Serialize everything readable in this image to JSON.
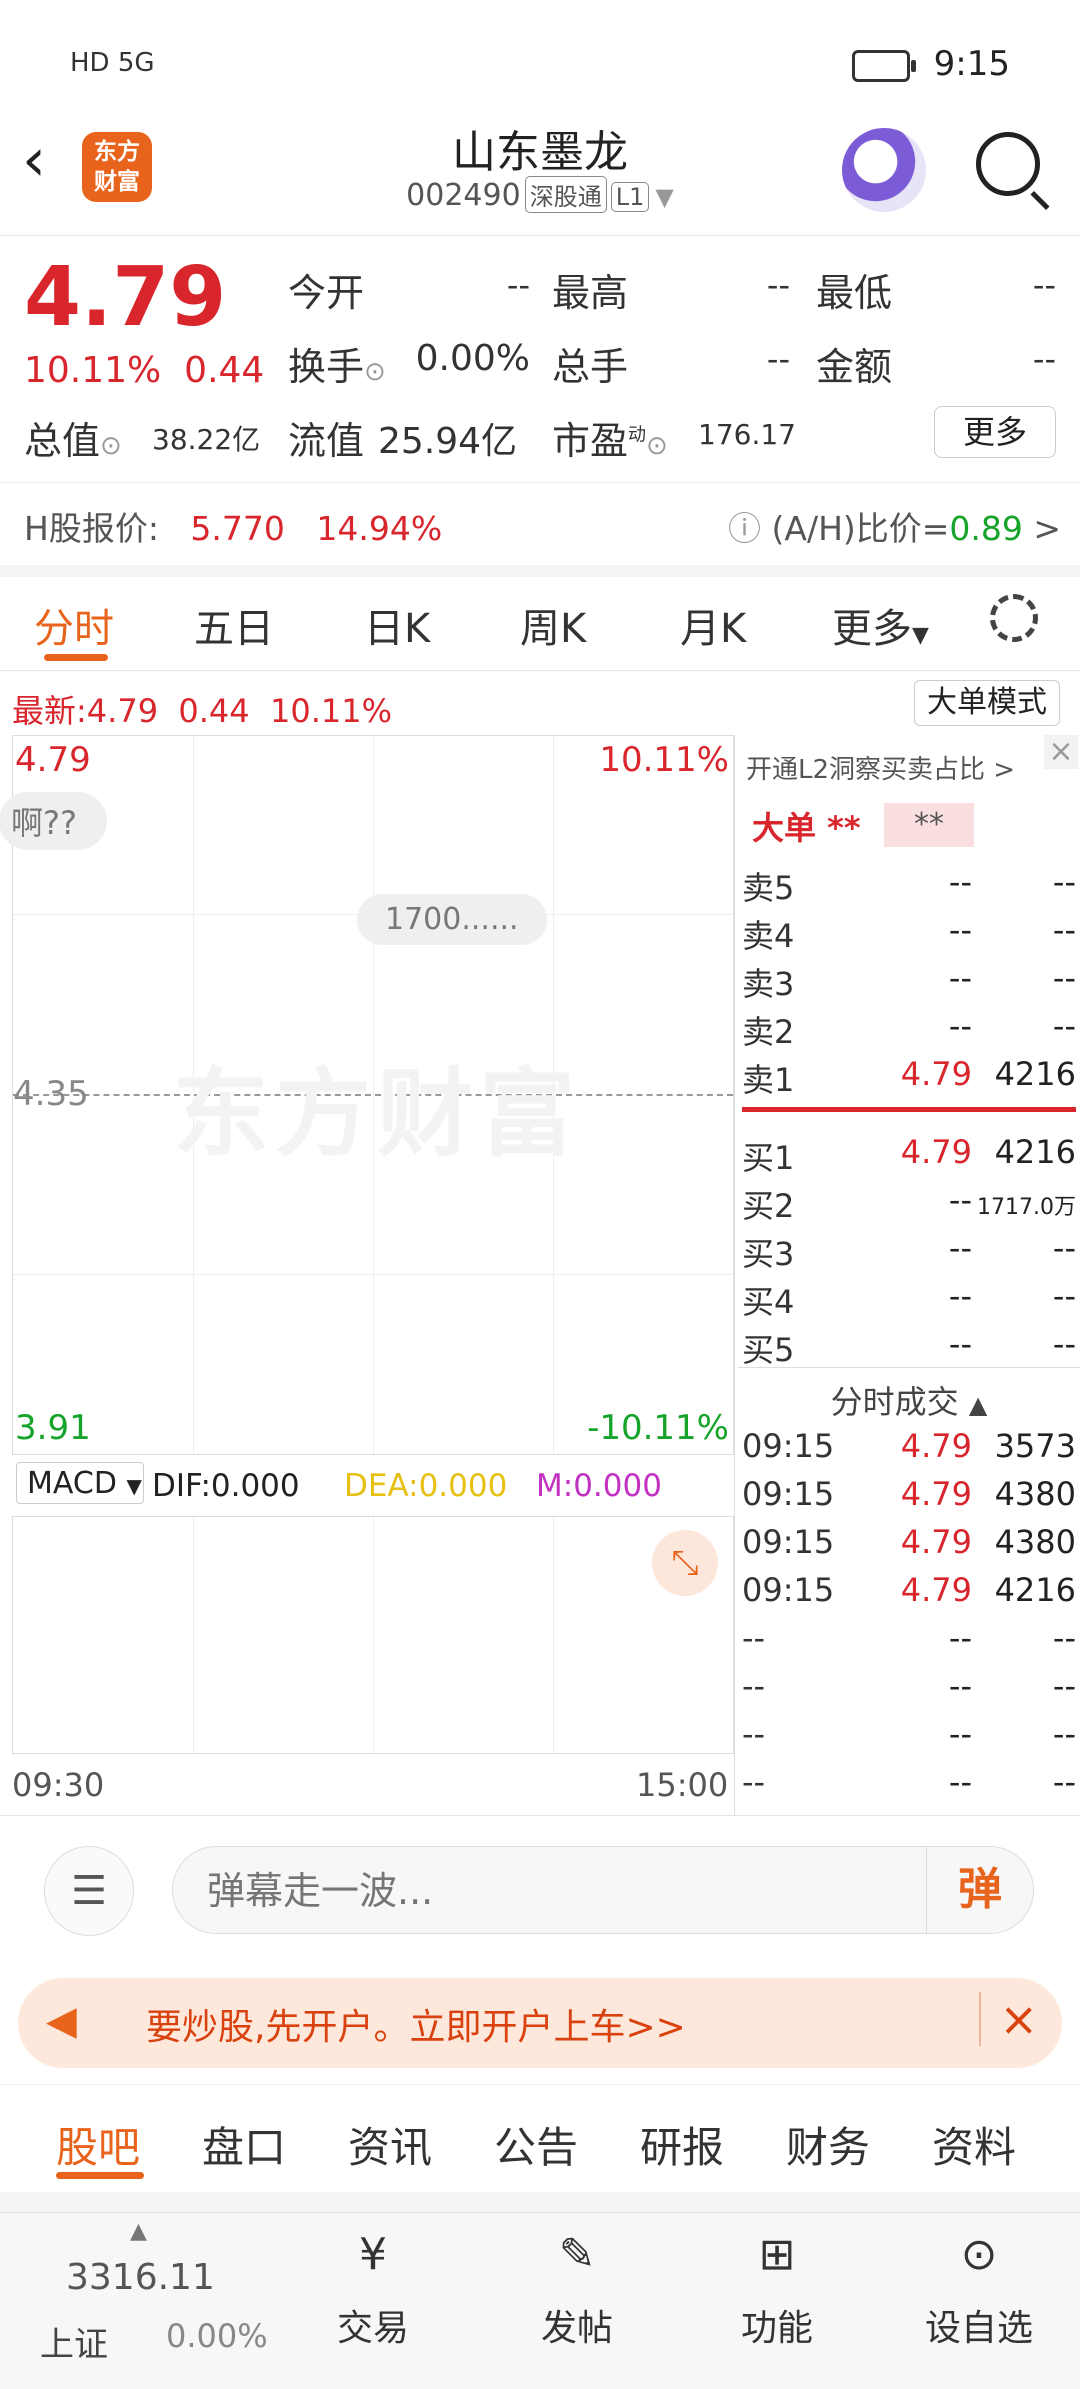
{
  "status": {
    "time": "9:15",
    "network": "HD 5G"
  },
  "header": {
    "logo_line1": "东方",
    "logo_line2": "财富",
    "stock_name": "山东墨龙",
    "stock_code": "002490",
    "tag1": "深股通",
    "tag2": "L1"
  },
  "quote": {
    "price": "4.79",
    "change_pct": "10.11%",
    "change": "0.44",
    "open_label": "今开",
    "open": "--",
    "high_label": "最高",
    "high": "--",
    "low_label": "最低",
    "low": "--",
    "turnover_label": "换手",
    "turnover": "0.00%",
    "volume_label": "总手",
    "volume": "--",
    "amount_label": "金额",
    "amount": "--",
    "mcap_label": "总值",
    "mcap": "38.22亿",
    "float_label": "流值",
    "float": "25.94亿",
    "pe_label": "市盈",
    "pe_sup": "动",
    "pe": "176.17",
    "more": "更多"
  },
  "hshare": {
    "label": "H股报价:",
    "price": "5.770",
    "pct": "14.94%",
    "ratio_label": "(A/H)比价=",
    "ratio": "0.89",
    "arrow": ">"
  },
  "tabs": [
    "分时",
    "五日",
    "日K",
    "周K",
    "月K",
    "更多"
  ],
  "latest": {
    "label": "最新:",
    "price": "4.79",
    "change": "0.44",
    "pct": "10.11%",
    "mode": "大单模式"
  },
  "chart": {
    "top_price": "4.79",
    "top_pct": "10.11%",
    "mid_price": "4.35",
    "bottom_price": "3.91",
    "bottom_pct": "-10.11%",
    "watermark": "东方财富",
    "danmu1": "啊??",
    "danmu2": "1700......",
    "start_time": "09:30",
    "end_time": "15:00"
  },
  "macd": {
    "select": "MACD",
    "dif": "DIF:0.000",
    "dea": "DEA:0.000",
    "m": "M:0.000"
  },
  "book": {
    "link": "开通L2洞察买卖占比 >",
    "bigdeal": "大单",
    "bigdeal_val": "**",
    "bigdeal_box": "**",
    "asks": [
      {
        "label": "卖5",
        "price": "--",
        "vol": "--"
      },
      {
        "label": "卖4",
        "price": "--",
        "vol": "--"
      },
      {
        "label": "卖3",
        "price": "--",
        "vol": "--"
      },
      {
        "label": "卖2",
        "price": "--",
        "vol": "--"
      },
      {
        "label": "卖1",
        "price": "4.79",
        "vol": "4216"
      }
    ],
    "bids": [
      {
        "label": "买1",
        "price": "4.79",
        "vol": "4216"
      },
      {
        "label": "买2",
        "price": "--",
        "vol": "1717.0万"
      },
      {
        "label": "买3",
        "price": "--",
        "vol": "--"
      },
      {
        "label": "买4",
        "price": "--",
        "vol": "--"
      },
      {
        "label": "买5",
        "price": "--",
        "vol": "--"
      }
    ],
    "trades_header": "分时成交",
    "trades": [
      {
        "t": "09:15",
        "p": "4.79",
        "v": "3573"
      },
      {
        "t": "09:15",
        "p": "4.79",
        "v": "4380"
      },
      {
        "t": "09:15",
        "p": "4.79",
        "v": "4380"
      },
      {
        "t": "09:15",
        "p": "4.79",
        "v": "4216"
      },
      {
        "t": "--",
        "p": "--",
        "v": "--"
      },
      {
        "t": "--",
        "p": "--",
        "v": "--"
      },
      {
        "t": "--",
        "p": "--",
        "v": "--"
      },
      {
        "t": "--",
        "p": "--",
        "v": "--"
      }
    ]
  },
  "danmu_input": {
    "placeholder": "弹幕走一波...",
    "button": "弹"
  },
  "banner": {
    "text": "要炒股,先开户。立即开户上车>>"
  },
  "bottom_tabs": [
    "股吧",
    "盘口",
    "资讯",
    "公告",
    "研报",
    "财务",
    "资料"
  ],
  "bottom_nav": {
    "index_value": "3316.11",
    "index_name": "上证",
    "index_pct": "0.00%",
    "items": [
      "交易",
      "发帖",
      "功能",
      "设自选"
    ]
  },
  "colors": {
    "accent": "#e8641c",
    "up": "#d9262c",
    "down": "#16a32a",
    "dea": "#e6c012",
    "m": "#c231c2"
  }
}
